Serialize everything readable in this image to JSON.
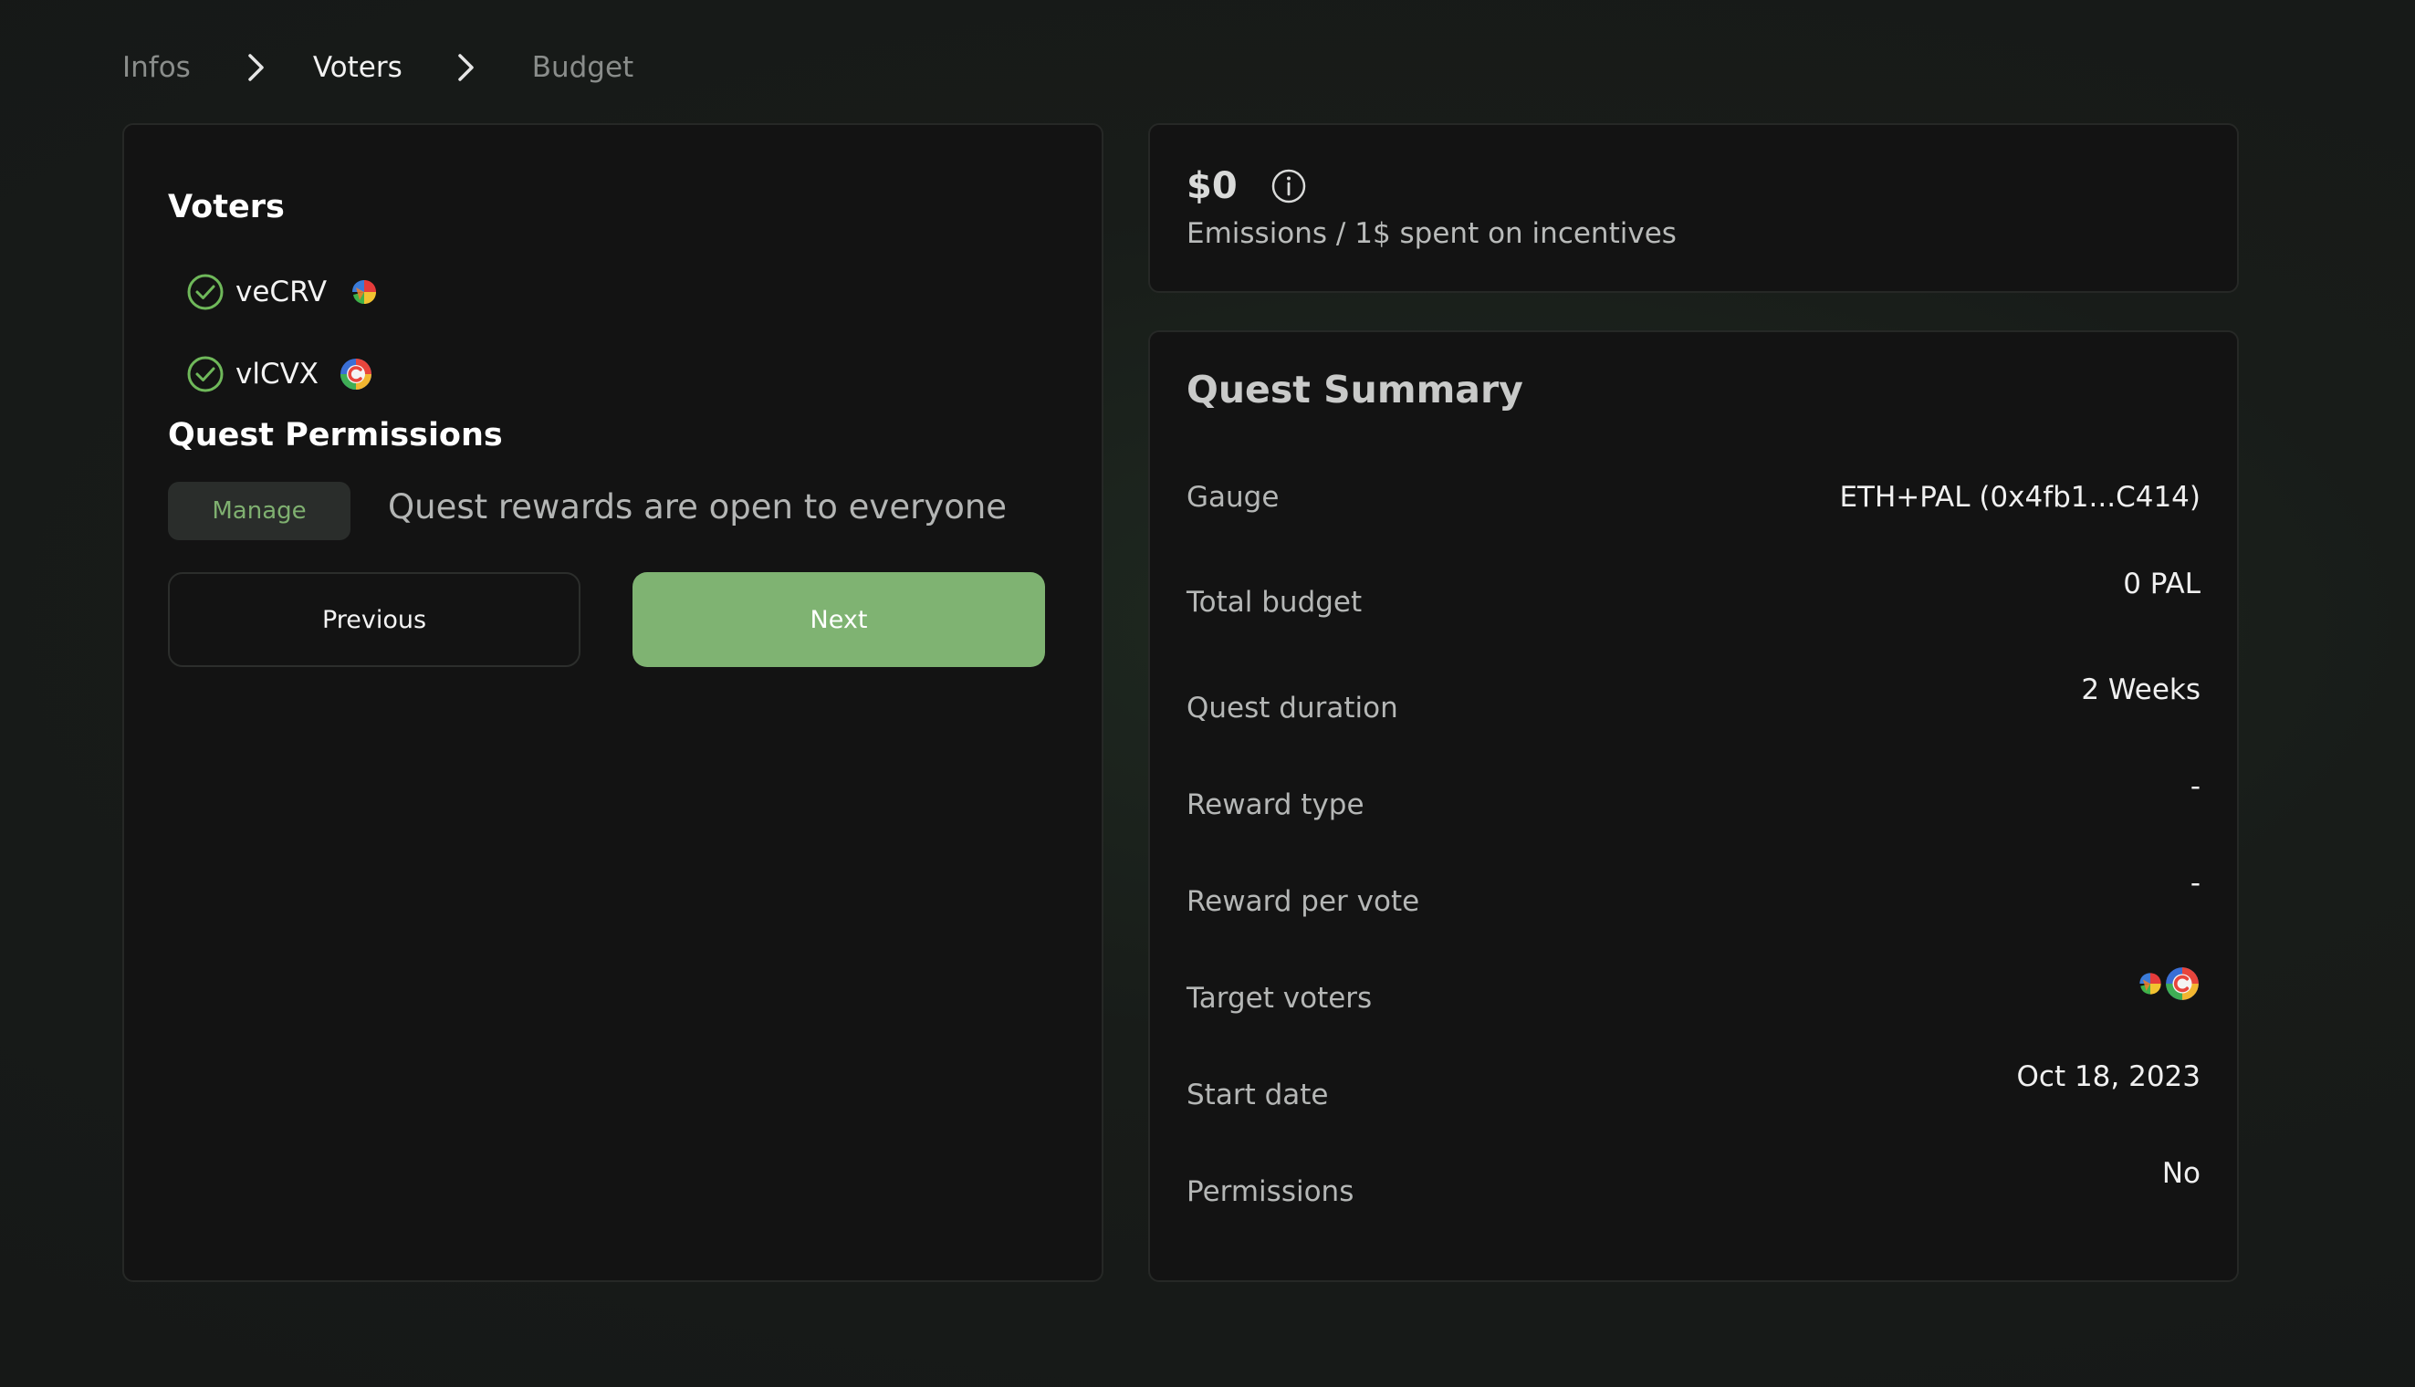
{
  "breadcrumb": {
    "steps": [
      "Infos",
      "Voters",
      "Budget"
    ]
  },
  "voters_section": {
    "title": "Voters",
    "items": [
      {
        "label": "veCRV",
        "icon": "vecrv-token-icon"
      },
      {
        "label": "vlCVX",
        "icon": "vlcvx-token-icon"
      }
    ]
  },
  "permissions_section": {
    "title": "Quest Permissions",
    "manage_label": "Manage",
    "description": "Quest rewards are open to everyone"
  },
  "actions": {
    "previous_label": "Previous",
    "next_label": "Next"
  },
  "emissions": {
    "value": "$0",
    "caption": "Emissions / 1$ spent on incentives"
  },
  "summary": {
    "title": "Quest Summary",
    "rows": [
      {
        "label": "Gauge",
        "value": "ETH+PAL (0x4fb1...C414)"
      },
      {
        "label": "Total budget",
        "value": "0 PAL"
      },
      {
        "label": "Quest duration",
        "value": "2 Weeks"
      },
      {
        "label": "Reward type",
        "value": "-"
      },
      {
        "label": "Reward per vote",
        "value": "-"
      },
      {
        "label": "Target voters",
        "value": ""
      },
      {
        "label": "Start date",
        "value": "Oct 18, 2023"
      },
      {
        "label": "Permissions",
        "value": "No"
      }
    ]
  },
  "colors": {
    "accent": "#7fb372",
    "check": "#6fb85a",
    "card_background": "#131313",
    "page_background": "#181c19"
  }
}
